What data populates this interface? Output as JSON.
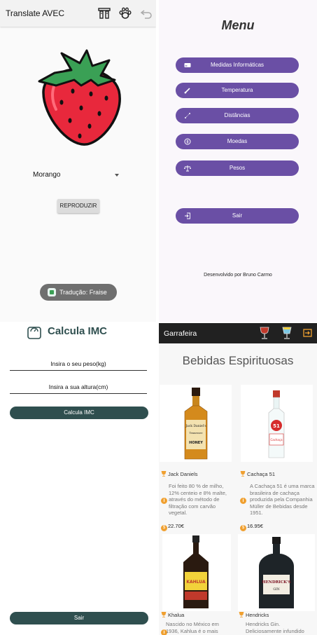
{
  "translate": {
    "title": "Translate AVEC",
    "toolbar_icons": [
      "dictionary-icon",
      "paw-icon",
      "undo-icon"
    ],
    "fruit_image": "strawberry",
    "spinner_value": "Morango",
    "play_button": "REPRODUZIR",
    "toast": "Tradução: Fraise"
  },
  "menu": {
    "title": "Menu",
    "items": [
      {
        "label": "Medidas Informáticas",
        "icon": "hard-drive-icon"
      },
      {
        "label": "Temperatura",
        "icon": "thermometer-icon"
      },
      {
        "label": "Distâncias",
        "icon": "distance-icon"
      },
      {
        "label": "Moedas",
        "icon": "coin-icon"
      },
      {
        "label": "Pesos",
        "icon": "scale-icon"
      }
    ],
    "exit": {
      "label": "Sair",
      "icon": "logout-icon"
    },
    "developer": "Desenvolvido por Bruno Carmo"
  },
  "imc": {
    "title": "Calcula IMC",
    "weight_placeholder": "Insira o seu peso(kg)",
    "height_placeholder": "Insira a sua altura(cm)",
    "calc_button": "Calcula IMC",
    "exit_button": "Sair"
  },
  "garrafeira": {
    "title": "Garrafeira",
    "section_title": "Bebidas Espirituosas",
    "drinks": [
      {
        "name": "Jack Daniels",
        "description": "Foi feito 80 % de milho, 12% centeio e 8% malte, através do método de filtração com carvão vegetal.",
        "price": "22.70€"
      },
      {
        "name": "Cachaça 51",
        "description": "A Cachaça 51 é uma marca brasileira de cachaça produzida pela Companhia Müller de Bebidas desde 1951.",
        "price": "16.95€"
      },
      {
        "name": "Khalua",
        "description": "Nascido no México em 1936, Kahlua é o mais"
      },
      {
        "name": "Hendricks",
        "description": "Hendricks Gin. Deliciosamente infundido"
      }
    ],
    "bottle_labels": {
      "jack": [
        "Jack Daniel's",
        "Tennessee",
        "HONEY"
      ],
      "cachaca": [
        "51",
        "Cachaça"
      ],
      "kahlua": [
        "KAHLUA"
      ],
      "hendricks": [
        "HENDRICK'S",
        "GIN"
      ]
    },
    "colors": {
      "appbar": "#212121",
      "accent": "#f0a030"
    }
  },
  "colors": {
    "menu_button": "#6a4fa5",
    "imc_button": "#2f4f4f",
    "strawberry": "#e8283c"
  }
}
